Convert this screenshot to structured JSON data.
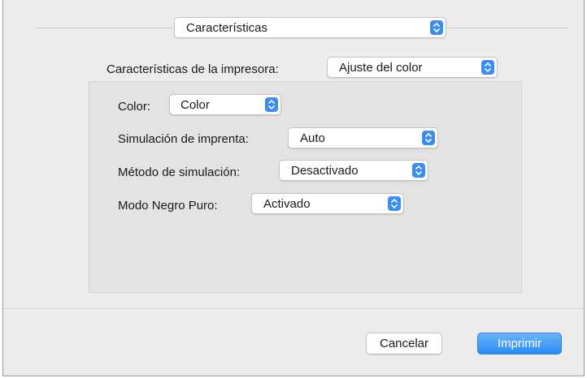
{
  "dialog": {
    "section_select": "Características",
    "printer_features_label": "Características de la impresora:",
    "printer_features_value": "Ajuste del color",
    "settings": {
      "color_label": "Color:",
      "color_value": "Color",
      "press_simulation_label": "Simulación de imprenta:",
      "press_simulation_value": "Auto",
      "simulation_method_label": "Método de simulación:",
      "simulation_method_value": "Desactivado",
      "black_mode_label": "Modo Negro Puro:",
      "black_mode_value": "Activado"
    },
    "buttons": {
      "cancel": "Cancelar",
      "print": "Imprimir"
    }
  },
  "colors": {
    "accent": "#3b8cf5",
    "dialog_background": "#ececec",
    "panel_background": "#e3e3e3"
  },
  "icons": {
    "stepper": "updown-chevron-icon"
  }
}
